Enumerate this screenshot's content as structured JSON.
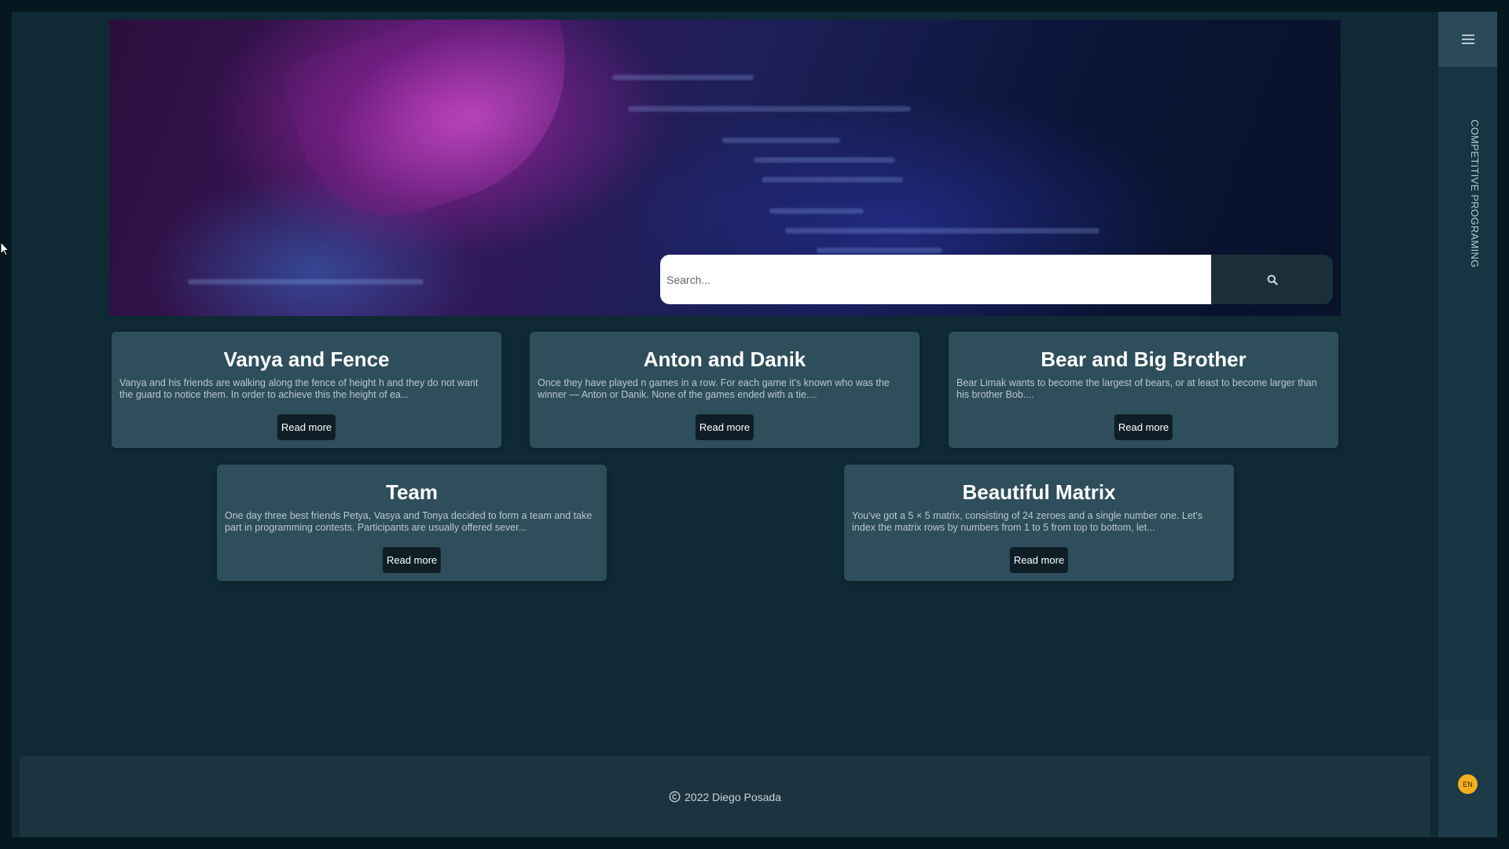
{
  "sidebar": {
    "title": "COMPETITIVE PROGRAMING",
    "menu_icon": "hamburger-icon",
    "language": "EN"
  },
  "search": {
    "placeholder": "Search...",
    "icon": "search-icon"
  },
  "cards": [
    {
      "title": "Vanya and Fence",
      "excerpt": "Vanya and his friends are walking along the fence of height h and they do not want the guard to notice them. In order to achieve this the height of ea...",
      "button": "Read more"
    },
    {
      "title": "Anton and Danik",
      "excerpt": "Once they have played n games in a row. For each game it's known who was the winner — Anton or Danik. None of the games ended with a tie....",
      "button": "Read more"
    },
    {
      "title": "Bear and Big Brother",
      "excerpt": "Bear Limak wants to become the largest of bears, or at least to become larger than his brother Bob....",
      "button": "Read more"
    },
    {
      "title": "Team",
      "excerpt": "One day three best friends Petya, Vasya and Tonya decided to form a team and take part in programming contests. Participants are usually offered sever...",
      "button": "Read more"
    },
    {
      "title": "Beautiful Matrix",
      "excerpt": "You've got a 5 × 5 matrix, consisting of 24 zeroes and a single number one. Let's index the matrix rows by numbers from 1 to 5 from top to bottom, let...",
      "button": "Read more"
    }
  ],
  "footer": {
    "text": "2022 Diego Posada",
    "icon": "copyright-icon"
  },
  "colors": {
    "background": "#0f2a35",
    "card": "#2f4e5c",
    "button": "#0f1e26",
    "badge": "#f2b01e"
  }
}
